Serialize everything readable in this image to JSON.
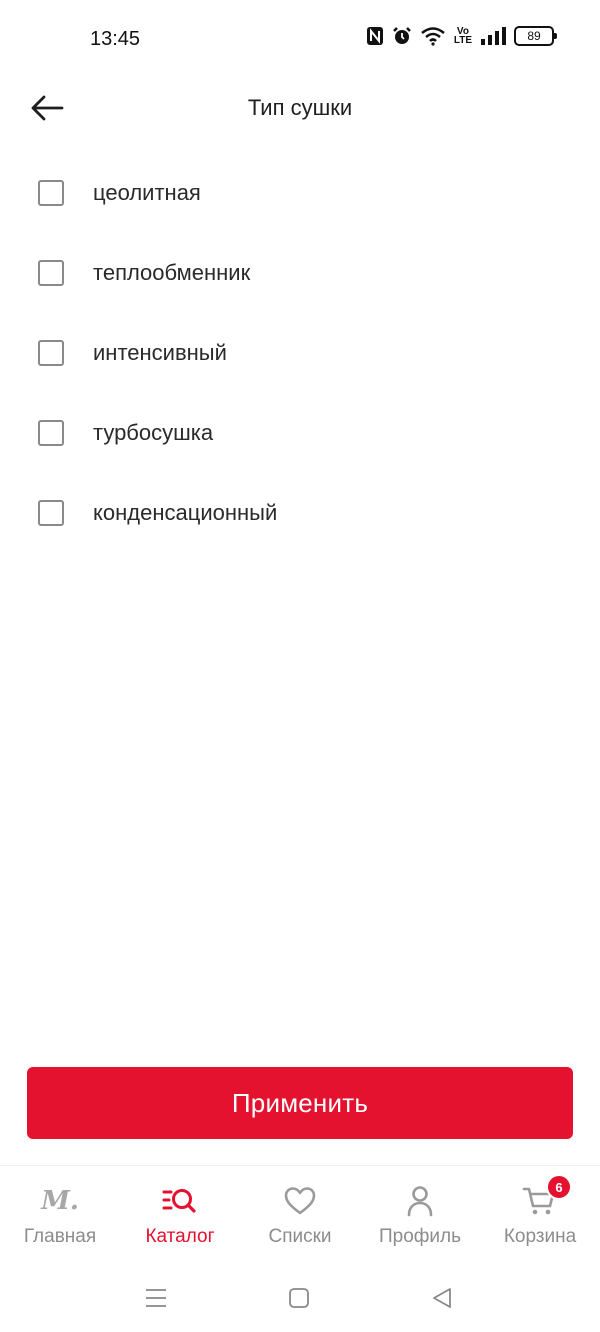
{
  "status_bar": {
    "time": "13:45",
    "volte_line1": "Vo",
    "volte_line2": "LTE",
    "battery_level": "89"
  },
  "header": {
    "title": "Тип сушки"
  },
  "options": [
    {
      "label": "цеолитная",
      "checked": false
    },
    {
      "label": "теплообменник",
      "checked": false
    },
    {
      "label": "интенсивный",
      "checked": false
    },
    {
      "label": "турбосушка",
      "checked": false
    },
    {
      "label": "конденсационный",
      "checked": false
    }
  ],
  "apply_button": {
    "label": "Применить"
  },
  "bottom_nav": {
    "items": [
      {
        "label": "Главная",
        "icon": "logo-icon",
        "logo_text": "M."
      },
      {
        "label": "Каталог",
        "icon": "catalog-search-icon",
        "active": true
      },
      {
        "label": "Списки",
        "icon": "heart-icon"
      },
      {
        "label": "Профиль",
        "icon": "person-icon"
      },
      {
        "label": "Корзина",
        "icon": "cart-icon",
        "badge": "6"
      }
    ]
  },
  "colors": {
    "accent": "#e4112f",
    "inactive": "#8c8c8c",
    "checkbox_border": "#8a8a8a"
  }
}
